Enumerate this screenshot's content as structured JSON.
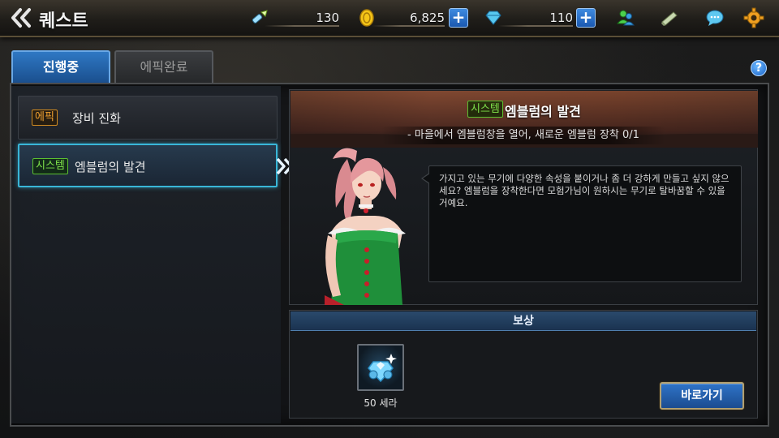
{
  "header": {
    "title": "퀘스트",
    "currencies": {
      "stamina": "130",
      "gold": "6,825",
      "gem": "110"
    }
  },
  "tabs": [
    {
      "label": "진행중",
      "active": true
    },
    {
      "label": "에픽완료",
      "active": false
    }
  ],
  "help_label": "?",
  "quests": [
    {
      "tag": "에픽",
      "name": "장비 진화"
    },
    {
      "tag": "시스템",
      "name": "엠블럼의 발견"
    }
  ],
  "detail": {
    "tag": "시스템",
    "title": "엠블럼의 발견",
    "objective": "- 마을에서 엠블럼창을 열어, 새로운 엠블럼 장착 0/1",
    "dialogue": "가지고 있는 무기에 다양한 속성을 붙이거나 좀 더 강하게 만들고 싶지 않으세요?  엠블럼을 장착한다면 모험가님이 원하시는 무기로 탈바꿈할 수 있을거예요."
  },
  "reward": {
    "header": "보상",
    "item_label": "50 세라"
  },
  "go_button": "바로가기",
  "colors": {
    "accent_blue": "#2f78c4",
    "selected_border": "#39b6d8",
    "epic_tag": "#f0a030",
    "system_tag": "#7ee04a"
  }
}
